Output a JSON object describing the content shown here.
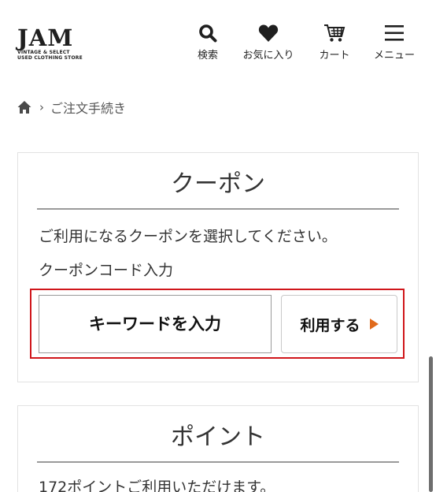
{
  "header": {
    "logo": {
      "main": "JAM",
      "sub1": "VINTAGE & SELECT",
      "sub2": "USED CLOTHING STORE"
    },
    "nav": [
      {
        "label": "検索",
        "icon": "search-icon"
      },
      {
        "label": "お気に入り",
        "icon": "heart-icon"
      },
      {
        "label": "カート",
        "icon": "cart-icon"
      },
      {
        "label": "メニュー",
        "icon": "menu-icon"
      }
    ]
  },
  "breadcrumb": {
    "home_icon": "home-icon",
    "current": "ご注文手続き"
  },
  "coupon": {
    "title": "クーポン",
    "description": "ご利用になるクーポンを選択してください。",
    "code_label": "クーポンコード入力",
    "input_placeholder": "キーワードを入力",
    "input_value": "",
    "use_button": "利用する",
    "accent_color": "#e06a1c",
    "highlight_color": "#d0161b"
  },
  "point": {
    "title": "ポイント",
    "available_text": "172ポイントご利用いただけます。"
  }
}
